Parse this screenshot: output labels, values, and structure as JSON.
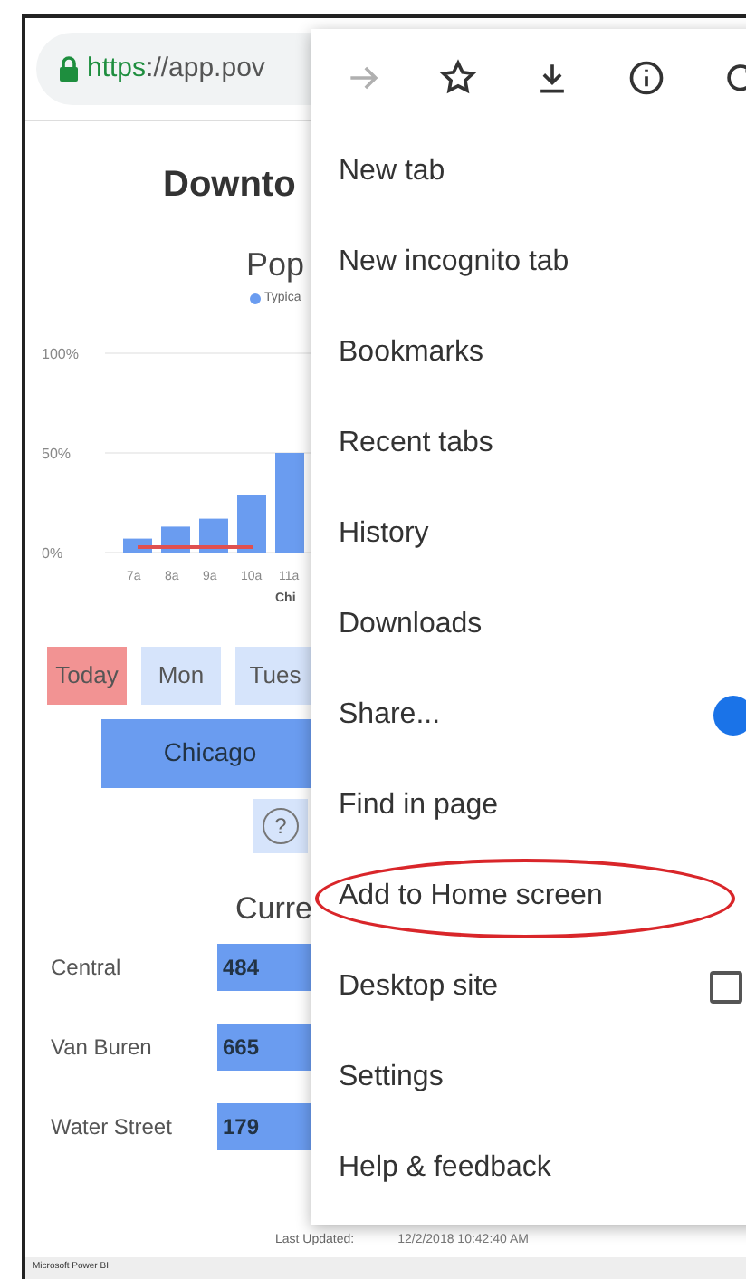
{
  "browser": {
    "url_scheme": "https",
    "url_rest": "://app.pov",
    "secure": true
  },
  "page": {
    "title": "Downto",
    "chart_heading": "Pop",
    "chart_data": {
      "type": "bar",
      "categories": [
        "7a",
        "8a",
        "9a",
        "10a",
        "11a"
      ],
      "xlabel": "Chi",
      "series": [
        {
          "name": "Typica",
          "color": "#6a9cf0",
          "values": [
            7,
            13,
            17,
            29,
            50
          ]
        }
      ],
      "ylim": [
        0,
        100
      ],
      "yticks": [
        {
          "value": 0,
          "label": "0%"
        },
        {
          "value": 50,
          "label": "50%"
        },
        {
          "value": 100,
          "label": "100%"
        }
      ]
    },
    "days": [
      {
        "label": "Today",
        "selected": true
      },
      {
        "label": "Mon",
        "selected": false
      },
      {
        "label": "Tues",
        "selected": false
      }
    ],
    "location": "Chicago",
    "help_icon": "?",
    "current_heading": "Curre",
    "stations": [
      {
        "name": "Central",
        "value": "484"
      },
      {
        "name": "Van Buren",
        "value": "665"
      },
      {
        "name": "Water Street",
        "value": "179"
      }
    ],
    "last_updated_label": "Last Updated:",
    "last_updated_value": "12/2/2018 10:42:40 AM",
    "footer": "Microsoft Power BI"
  },
  "menu": {
    "toolbar": [
      {
        "kind": "forward",
        "disabled": true
      },
      {
        "kind": "star",
        "disabled": false
      },
      {
        "kind": "download",
        "disabled": false
      },
      {
        "kind": "info",
        "disabled": false
      },
      {
        "kind": "refresh",
        "disabled": false
      }
    ],
    "items": [
      {
        "label": "New tab",
        "kind": "plain"
      },
      {
        "label": "New incognito tab",
        "kind": "plain"
      },
      {
        "label": "Bookmarks",
        "kind": "plain"
      },
      {
        "label": "Recent tabs",
        "kind": "plain"
      },
      {
        "label": "History",
        "kind": "plain"
      },
      {
        "label": "Downloads",
        "kind": "plain"
      },
      {
        "label": "Share...",
        "kind": "app"
      },
      {
        "label": "Find in page",
        "kind": "plain"
      },
      {
        "label": "Add to Home screen",
        "kind": "plain",
        "circled": true
      },
      {
        "label": "Desktop site",
        "kind": "checkbox",
        "checked": false
      },
      {
        "label": "Settings",
        "kind": "plain"
      },
      {
        "label": "Help & feedback",
        "kind": "plain"
      }
    ]
  }
}
